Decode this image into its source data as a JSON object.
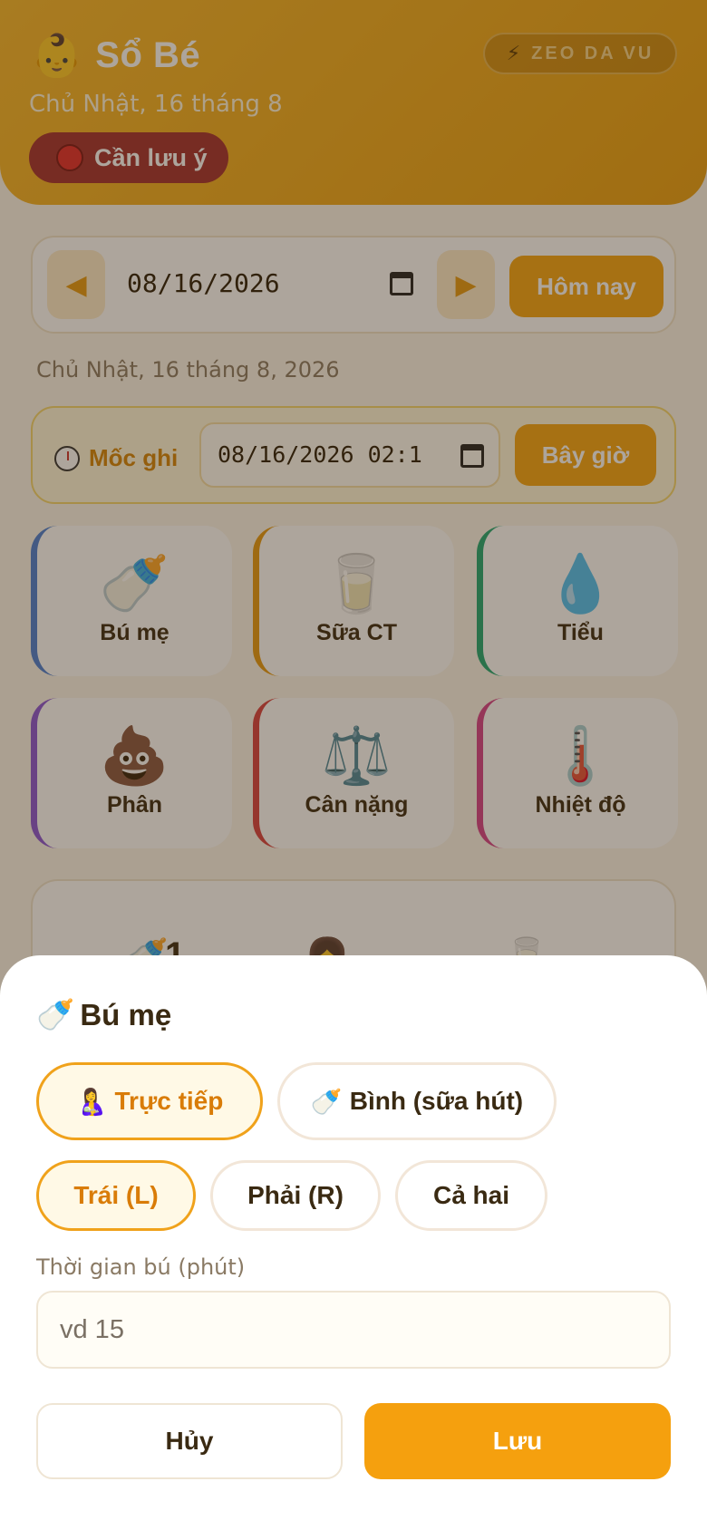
{
  "header": {
    "logo_emoji": "👶",
    "title": "Sổ Bé",
    "date": "Chủ Nhật, 16 tháng 8",
    "alert_label": "Cần lưu ý",
    "user_icon": "⚡",
    "user_name": "ZEO DA VU"
  },
  "date_nav": {
    "prev_icon": "◀",
    "next_icon": "▶",
    "date_value": "08/16/2026",
    "today_label": "Hôm nay",
    "caption": "Chủ Nhật, 16 tháng 8, 2026"
  },
  "timestamp": {
    "label": "Mốc ghi",
    "value": "08/16/2026 02:1",
    "now_label": "Bây giờ"
  },
  "quick_actions": [
    {
      "emoji": "🍼",
      "label": "Bú mẹ",
      "color": "#4a7fd4"
    },
    {
      "emoji": "🥛",
      "label": "Sữa CT",
      "color": "#e69a12"
    },
    {
      "emoji": "💧",
      "label": "Tiểu",
      "color": "#1fa774"
    },
    {
      "emoji": "💩",
      "label": "Phân",
      "color": "#8b55d6"
    },
    {
      "emoji": "⚖️",
      "label": "Cân nặng",
      "color": "#d84040"
    },
    {
      "emoji": "🌡️",
      "label": "Nhiệt độ",
      "color": "#d6408a"
    }
  ],
  "summary": {
    "item1_emoji": "🍼",
    "item1_count": "1",
    "item2_emoji": "👧",
    "item3_emoji": "🥛"
  },
  "sheet": {
    "title_emoji": "🍼",
    "title": "Bú mẹ",
    "method_direct_emoji": "🤱",
    "method_direct": "Trực tiếp",
    "method_bottle_emoji": "🍼",
    "method_bottle": "Bình (sữa hút)",
    "side_left": "Trái (L)",
    "side_right": "Phải (R)",
    "side_both": "Cả hai",
    "duration_label": "Thời gian bú (phút)",
    "duration_placeholder": "vd 15",
    "cancel_label": "Hủy",
    "save_label": "Lưu"
  },
  "colors": {
    "accent": "#f5a514",
    "alert": "#a33030"
  }
}
